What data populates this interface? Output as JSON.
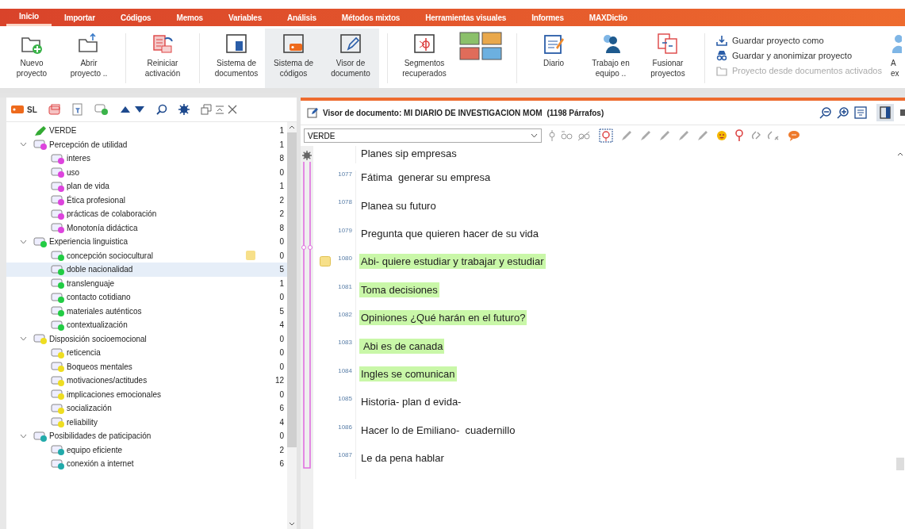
{
  "menu": [
    {
      "label": "Inicio",
      "selected": true
    },
    {
      "label": "Importar",
      "selected": false
    },
    {
      "label": "Códigos",
      "selected": false
    },
    {
      "label": "Memos",
      "selected": false
    },
    {
      "label": "Variables",
      "selected": false
    },
    {
      "label": "Análisis",
      "selected": false
    },
    {
      "label": "Métodos mixtos",
      "selected": false
    },
    {
      "label": "Herramientas visuales",
      "selected": false
    },
    {
      "label": "Informes",
      "selected": false
    },
    {
      "label": "MAXDictio",
      "selected": false
    }
  ],
  "ribbon": {
    "buttons": [
      {
        "label": "Nuevo proyecto",
        "selected": false
      },
      {
        "label": "Abrir proyecto ..",
        "selected": false
      },
      {
        "label": "Reiniciar activación",
        "selected": false
      },
      {
        "label": "Sistema de documentos",
        "selected": false
      },
      {
        "label": "Sistema de códigos",
        "selected": true
      },
      {
        "label": "Visor de documento",
        "selected": true
      },
      {
        "label": "Segmentos recuperados",
        "selected": false
      },
      {
        "selected": false
      },
      {
        "label": "Diario",
        "selected": false
      },
      {
        "label": "Trabajo en equipo ..",
        "selected": false
      },
      {
        "label": "Fusionar proyectos",
        "selected": false
      }
    ],
    "commands": [
      {
        "label": "Guardar proyecto como",
        "disabled": false
      },
      {
        "label": "Guardar y anonimizar proyecto",
        "disabled": false
      },
      {
        "label": "Proyecto desde documentos activados",
        "disabled": true
      }
    ],
    "cut_button": [
      "A",
      "ex"
    ]
  },
  "code_panel": {
    "toolbar_label": "SL",
    "tree": [
      {
        "label": "VERDE",
        "count": "1",
        "kind": "color-code",
        "color": "#33aa33",
        "selected": false
      },
      {
        "label": "Percepción de utilidad",
        "count": "1",
        "color": "#dd44dd",
        "expanded": true,
        "selected": false,
        "children": [
          {
            "label": "interes",
            "count": "8",
            "color": "#dd44dd",
            "selected": false
          },
          {
            "label": "uso",
            "count": "0",
            "color": "#dd44dd",
            "selected": false
          },
          {
            "label": "plan de vida",
            "count": "1",
            "color": "#dd44dd",
            "selected": false
          },
          {
            "label": "Ética profesional",
            "count": "2",
            "color": "#dd44dd",
            "selected": false
          },
          {
            "label": "prácticas de colaboración",
            "count": "2",
            "color": "#dd44dd",
            "selected": false
          },
          {
            "label": "Monotonía didáctica",
            "count": "8",
            "color": "#dd44dd",
            "selected": false
          }
        ]
      },
      {
        "label": "Experiencia linguistica",
        "count": "0",
        "color": "#22cc44",
        "expanded": true,
        "selected": false,
        "children": [
          {
            "label": "concepción sociocultural",
            "count": "0",
            "color": "#22cc44",
            "memo": true,
            "selected": false
          },
          {
            "label": "doble nacionalidad",
            "count": "5",
            "color": "#22cc44",
            "selected": true
          },
          {
            "label": "translenguaje",
            "count": "1",
            "color": "#22cc44",
            "selected": false
          },
          {
            "label": "contacto cotidiano",
            "count": "0",
            "color": "#22cc44",
            "selected": false
          },
          {
            "label": "materiales auténticos",
            "count": "5",
            "color": "#22cc44",
            "selected": false
          },
          {
            "label": "contextualización",
            "count": "4",
            "color": "#22cc44",
            "selected": false
          }
        ]
      },
      {
        "label": "Disposición socioemocional",
        "count": "0",
        "color": "#eedd22",
        "expanded": true,
        "selected": false,
        "children": [
          {
            "label": "reticencia",
            "count": "0",
            "color": "#eedd22",
            "selected": false
          },
          {
            "label": "Boqueos mentales",
            "count": "0",
            "color": "#eedd22",
            "selected": false
          },
          {
            "label": "motivaciones/actitudes",
            "count": "12",
            "color": "#eedd22",
            "selected": false
          },
          {
            "label": "implicaciones emocionales",
            "count": "0",
            "color": "#eedd22",
            "selected": false
          },
          {
            "label": "socialización",
            "count": "6",
            "color": "#eedd22",
            "selected": false
          },
          {
            "label": "reliability",
            "count": "4",
            "color": "#eedd22",
            "selected": false
          }
        ]
      },
      {
        "label": "Posibilidades de paticipación",
        "count": "0",
        "color": "#22aaaa",
        "expanded": true,
        "selected": false,
        "children": [
          {
            "label": "equipo eficiente",
            "count": "2",
            "color": "#22aaaa",
            "selected": false
          },
          {
            "label": "conexión a internet",
            "count": "6",
            "color": "#22aaaa",
            "selected": false
          }
        ]
      }
    ]
  },
  "document_viewer": {
    "title": "Visor de documento: MI DIARIO DE INVESTIGACION MOM",
    "paragraph_count": "(1198 Párrafos)",
    "code_field": "VERDE",
    "paragraphs": [
      {
        "text": "Planes sip empresas",
        "coded": false,
        "memo": false
      },
      {
        "number": "1077",
        "text": "Fátima  generar su empresa",
        "coded": false,
        "memo": false
      },
      {
        "number": "1078",
        "text": "Planea su futuro",
        "coded": false,
        "memo": false
      },
      {
        "number": "1079",
        "text": "Pregunta que quieren hacer de su vida",
        "coded": false,
        "memo": false
      },
      {
        "number": "1080",
        "text": "Abi- quiere estudiar y trabajar y estudiar",
        "coded": true,
        "memo": true
      },
      {
        "number": "1081",
        "text": "Toma decisiones",
        "coded": true,
        "memo": false
      },
      {
        "number": "1082",
        "text": "Opiniones ¿Qué harán en el futuro?",
        "coded": true,
        "memo": false
      },
      {
        "number": "1083",
        "text": " Abi es de canada",
        "coded": true,
        "memo": false
      },
      {
        "number": "1084",
        "text": "Ingles se comunican",
        "coded": true,
        "memo": false
      },
      {
        "number": "1085",
        "text": "Historia- plan d evida-",
        "coded": false,
        "memo": false
      },
      {
        "number": "1086",
        "text": "Hacer lo de Emiliano-  cuadernillo",
        "coded": false,
        "memo": false
      },
      {
        "number": "1087",
        "text": "Le da pena hablar",
        "coded": false,
        "memo": false
      }
    ]
  }
}
